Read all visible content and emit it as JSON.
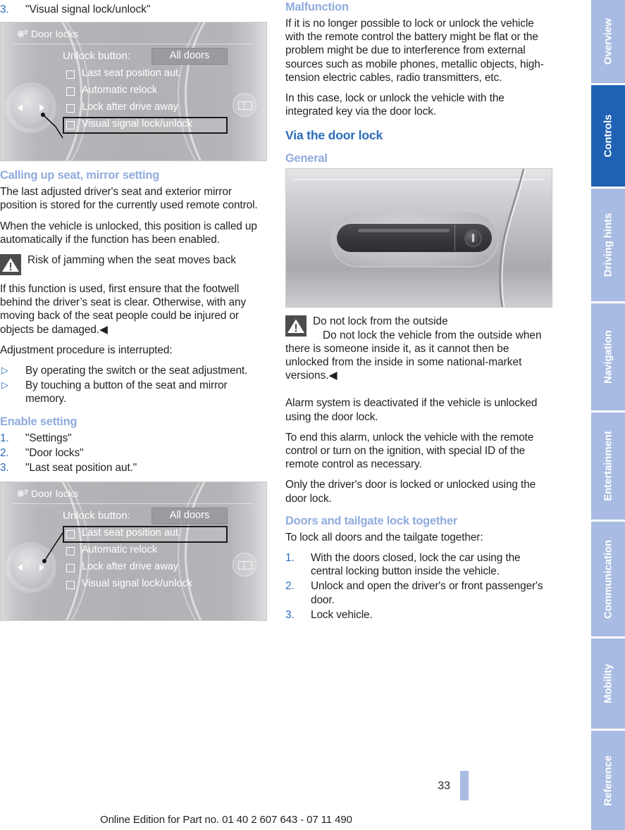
{
  "page": {
    "number": "33",
    "footer_note": "Online Edition for Part no. 01 40 2 607 643 - 07 11 490"
  },
  "colors": {
    "heading_light_blue": "#8fabdd",
    "heading_blue": "#2b6cb8",
    "tab_inactive": "#a8bbe2",
    "tab_active": "#1f62b4",
    "warning_icon_bg": "#4c4c4c"
  },
  "left_column": {
    "step3": {
      "num": "3.",
      "text": "\"Visual signal lock/unlock\""
    },
    "figure1": {
      "title": "Door locks",
      "icon": "gear-icon",
      "unlock_label": "Unlock button:",
      "unlock_value": "All doors",
      "options": [
        "Last seat position aut.",
        "Automatic relock",
        "Lock after drive away",
        "Visual signal lock/unlock"
      ],
      "selected_option": "Visual signal lock/unlock"
    },
    "heading_calling_up": "Calling up seat, mirror setting",
    "para1": "The last adjusted driver's seat and exterior mirror position is stored for the currently used remote control.",
    "para2": "When the vehicle is unlocked, this position is called up automatically if the function has been enabled.",
    "warning": {
      "title": "Risk of jamming when the seat moves back",
      "body": "If this function is used, first ensure that the footwell behind the driver’s seat is clear. Otherwise, with any moving back of the seat people could be injured or objects be damaged.◀"
    },
    "para3": "Adjustment procedure is interrupted:",
    "interrupt_items": [
      "By operating the switch or the seat adjustment.",
      "By touching a button of the seat and mirror memory."
    ],
    "heading_enable_setting": "Enable setting",
    "enable_steps": [
      {
        "num": "1.",
        "text": "\"Settings\""
      },
      {
        "num": "2.",
        "text": "\"Door locks\""
      },
      {
        "num": "3.",
        "text": "\"Last seat position aut.\""
      }
    ],
    "figure2": {
      "title": "Door locks",
      "icon": "gear-icon",
      "unlock_label": "Unlock button:",
      "unlock_value": "All doors",
      "options": [
        "Last seat position aut.",
        "Automatic relock",
        "Lock after drive away",
        "Visual signal lock/unlock"
      ],
      "selected_option": "Last seat position aut."
    }
  },
  "right_column": {
    "heading_malfunction": "Malfunction",
    "para1": "If it is no longer possible to lock or unlock the vehicle with the remote control the battery might be flat or the problem might be due to interference from external sources such as mobile phones, metallic objects, high-tension electric cables, radio transmitters, etc.",
    "para2": "In this case, lock or unlock the vehicle with the integrated key via the door lock.",
    "heading_via_door_lock": "Via the door lock",
    "heading_general": "General",
    "figure_door": {
      "alt": "door-handle-illustration"
    },
    "warning": {
      "title": "Do not lock from the outside",
      "body": "Do not lock the vehicle from the outside when there is someone inside it, as it cannot then be unlocked from the inside in some national-market versions.◀"
    },
    "para3": "Alarm system is deactivated if the vehicle is unlocked using the door lock.",
    "para4": "To end this alarm, unlock the vehicle with the remote control or turn on the ignition, with special ID of the remote control as necessary.",
    "para5": "Only the driver's door is locked or unlocked using the door lock.",
    "heading_doors_tailgate": "Doors and tailgate lock together",
    "para6": "To lock all doors and the tailgate together:",
    "lock_steps": [
      {
        "num": "1.",
        "text": "With the doors closed, lock the car using the central locking button inside the vehicle."
      },
      {
        "num": "2.",
        "text": "Unlock and open the driver's or front passenger's door."
      },
      {
        "num": "3.",
        "text": "Lock vehicle."
      }
    ]
  },
  "tabs": [
    {
      "label": "Overview",
      "active": false
    },
    {
      "label": "Controls",
      "active": true
    },
    {
      "label": "Driving hints",
      "active": false
    },
    {
      "label": "Navigation",
      "active": false
    },
    {
      "label": "Entertainment",
      "active": false
    },
    {
      "label": "Communication",
      "active": false
    },
    {
      "label": "Mobility",
      "active": false
    },
    {
      "label": "Reference",
      "active": false
    }
  ]
}
